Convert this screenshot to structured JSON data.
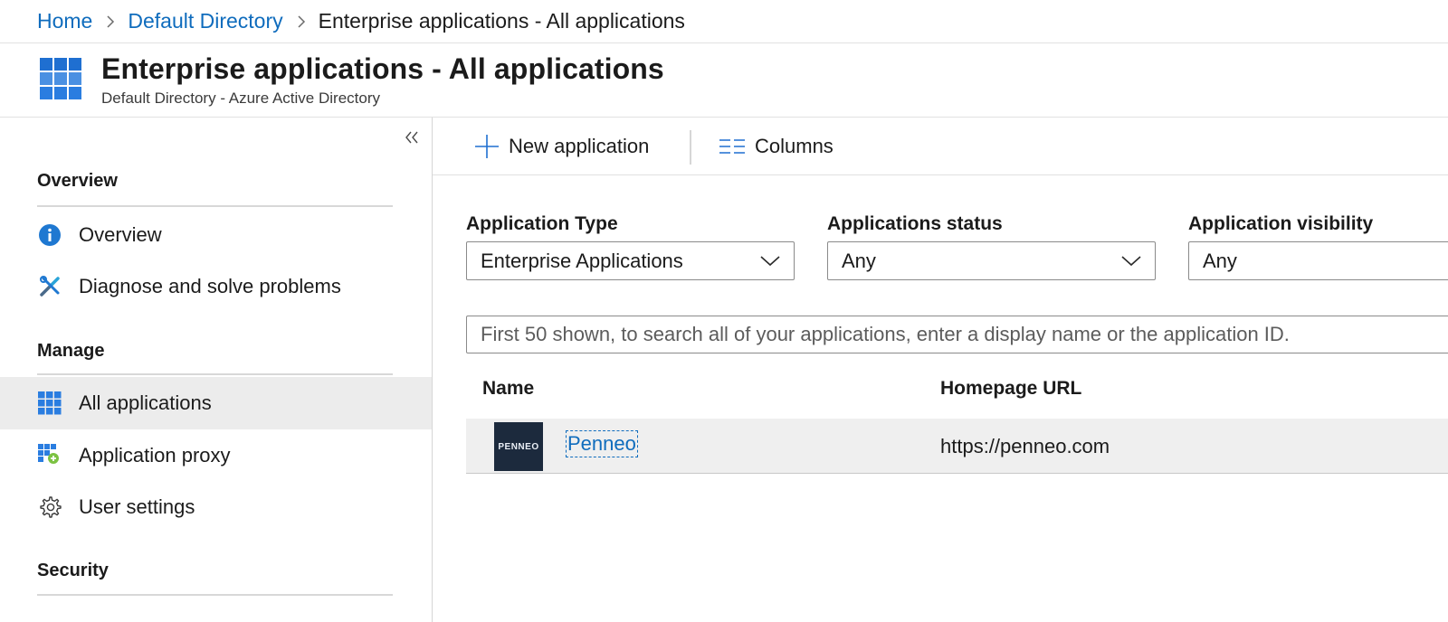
{
  "breadcrumb": {
    "home": "Home",
    "directory": "Default Directory",
    "current": "Enterprise applications - All applications"
  },
  "header": {
    "title": "Enterprise applications - All applications",
    "subtitle": "Default Directory - Azure Active Directory",
    "icon": "app-grid-icon"
  },
  "sidebar": {
    "collapse_icon": "double-chevron-left-icon",
    "sections": {
      "overview": "Overview",
      "manage": "Manage",
      "security": "Security"
    },
    "items": [
      {
        "label": "Overview",
        "icon": "info-icon"
      },
      {
        "label": "Diagnose and solve problems",
        "icon": "wrench-icon"
      },
      {
        "label": "All applications",
        "icon": "app-grid-icon",
        "active": true
      },
      {
        "label": "Application proxy",
        "icon": "app-proxy-icon"
      },
      {
        "label": "User settings",
        "icon": "gear-icon"
      }
    ]
  },
  "toolbar": {
    "new_application": "New application",
    "columns": "Columns"
  },
  "filters": {
    "app_type": {
      "label": "Application Type",
      "value": "Enterprise Applications"
    },
    "status": {
      "label": "Applications status",
      "value": "Any"
    },
    "visibility": {
      "label": "Application visibility",
      "value": "Any"
    }
  },
  "search": {
    "placeholder": "First 50 shown, to search all of your applications, enter a display name or the application ID."
  },
  "table": {
    "columns": [
      "Name",
      "Homepage URL"
    ],
    "rows": [
      {
        "name": "Penneo",
        "logo_text": "PENNEO",
        "homepage": "https://penneo.com"
      }
    ]
  },
  "colors": {
    "link": "#0f6cbd",
    "active_bg": "#ececec",
    "logo_bg": "#1c2a3d"
  }
}
